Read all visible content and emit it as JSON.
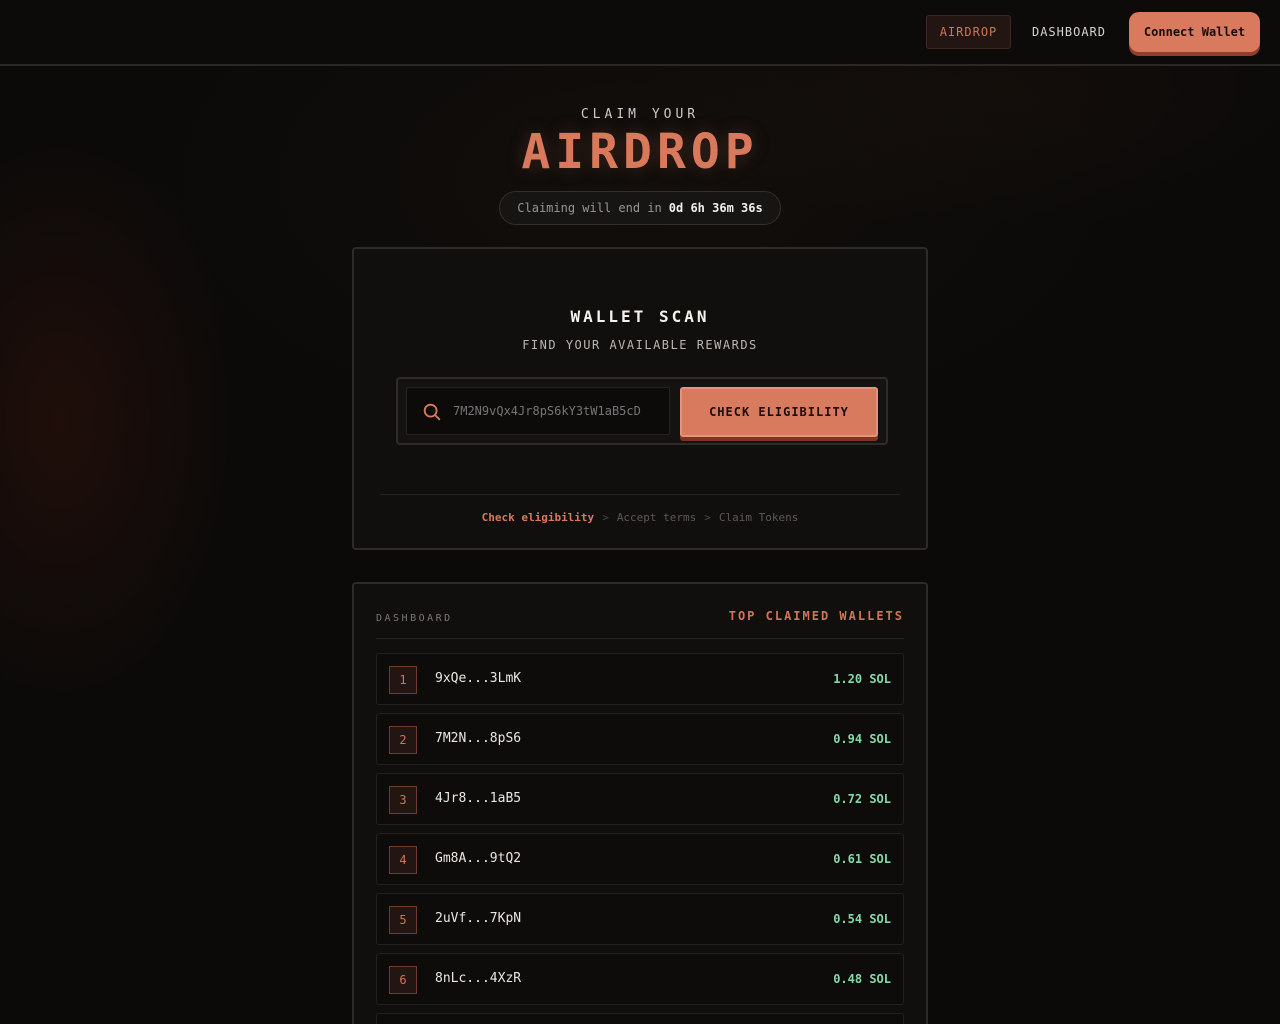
{
  "nav": {
    "airdrop_label": "AIRDROP",
    "dashboard_label": "DASHBOARD",
    "connect_label": "Connect Wallet"
  },
  "hero": {
    "kicker": "CLAIM YOUR",
    "title": "AIRDROP",
    "countdown_prefix": "Claiming will end in",
    "countdown_value": "0d 6h 36m 36s"
  },
  "scan": {
    "title": "WALLET SCAN",
    "subtitle": "FIND YOUR AVAILABLE REWARDS",
    "input_placeholder": "7M2N9vQx4Jr8pS6kY3tW1aB5cD",
    "check_label": "CHECK ELIGIBILITY",
    "steps": [
      "Check eligibility",
      "Accept terms",
      "Claim Tokens"
    ],
    "step_separator": ">"
  },
  "dashboard": {
    "label": "DASHBOARD",
    "heading": "TOP CLAIMED WALLETS",
    "wallets": [
      {
        "rank": "1",
        "address": "9xQe...3LmK",
        "amount": "1.20 SOL"
      },
      {
        "rank": "2",
        "address": "7M2N...8pS6",
        "amount": "0.94 SOL"
      },
      {
        "rank": "3",
        "address": "4Jr8...1aB5",
        "amount": "0.72 SOL"
      },
      {
        "rank": "4",
        "address": "Gm8A...9tQ2",
        "amount": "0.61 SOL"
      },
      {
        "rank": "5",
        "address": "2uVf...7KpN",
        "amount": "0.54 SOL"
      },
      {
        "rank": "6",
        "address": "8nLc...4XzR",
        "amount": "0.48 SOL"
      }
    ]
  },
  "colors": {
    "accent": "#d8795c",
    "positive": "#86d8a8",
    "background": "#0b0a09"
  }
}
